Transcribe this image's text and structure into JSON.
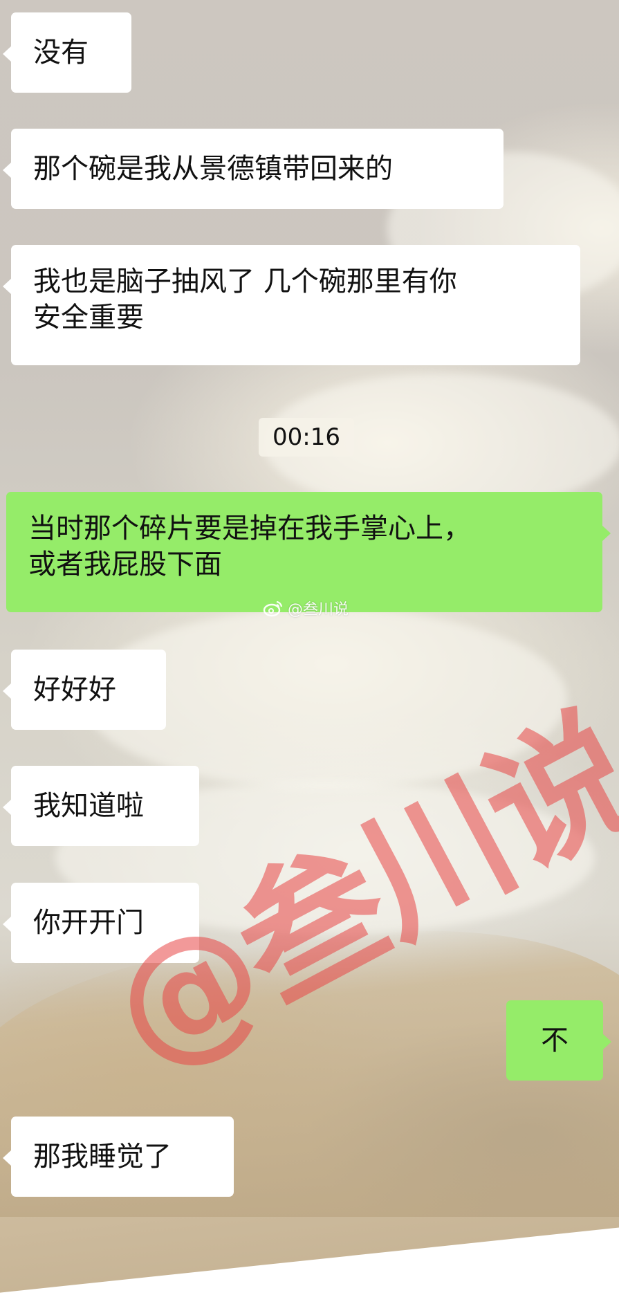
{
  "messages": [
    {
      "side": "left",
      "text": "没有"
    },
    {
      "side": "left",
      "text": "那个碗是我从景德镇带回来的"
    },
    {
      "side": "left",
      "text": "我也是脑子抽风了 几个碗那里有你\n安全重要"
    },
    {
      "side": "time",
      "text": "00:16"
    },
    {
      "side": "right",
      "text": "当时那个碎片要是掉在我手掌心上，\n或者我屁股下面"
    },
    {
      "side": "left",
      "text": "好好好"
    },
    {
      "side": "left",
      "text": "我知道啦"
    },
    {
      "side": "left",
      "text": "你开开门"
    },
    {
      "side": "right",
      "text": "不"
    },
    {
      "side": "left",
      "text": "那我睡觉了"
    }
  ],
  "watermarks": {
    "weibo_small": "@叁川说",
    "large": "@叁川说"
  },
  "colors": {
    "incoming_bubble": "#ffffff",
    "outgoing_bubble": "#95ec69",
    "watermark": "#e84646"
  },
  "icons": {
    "weibo": "weibo-icon"
  }
}
